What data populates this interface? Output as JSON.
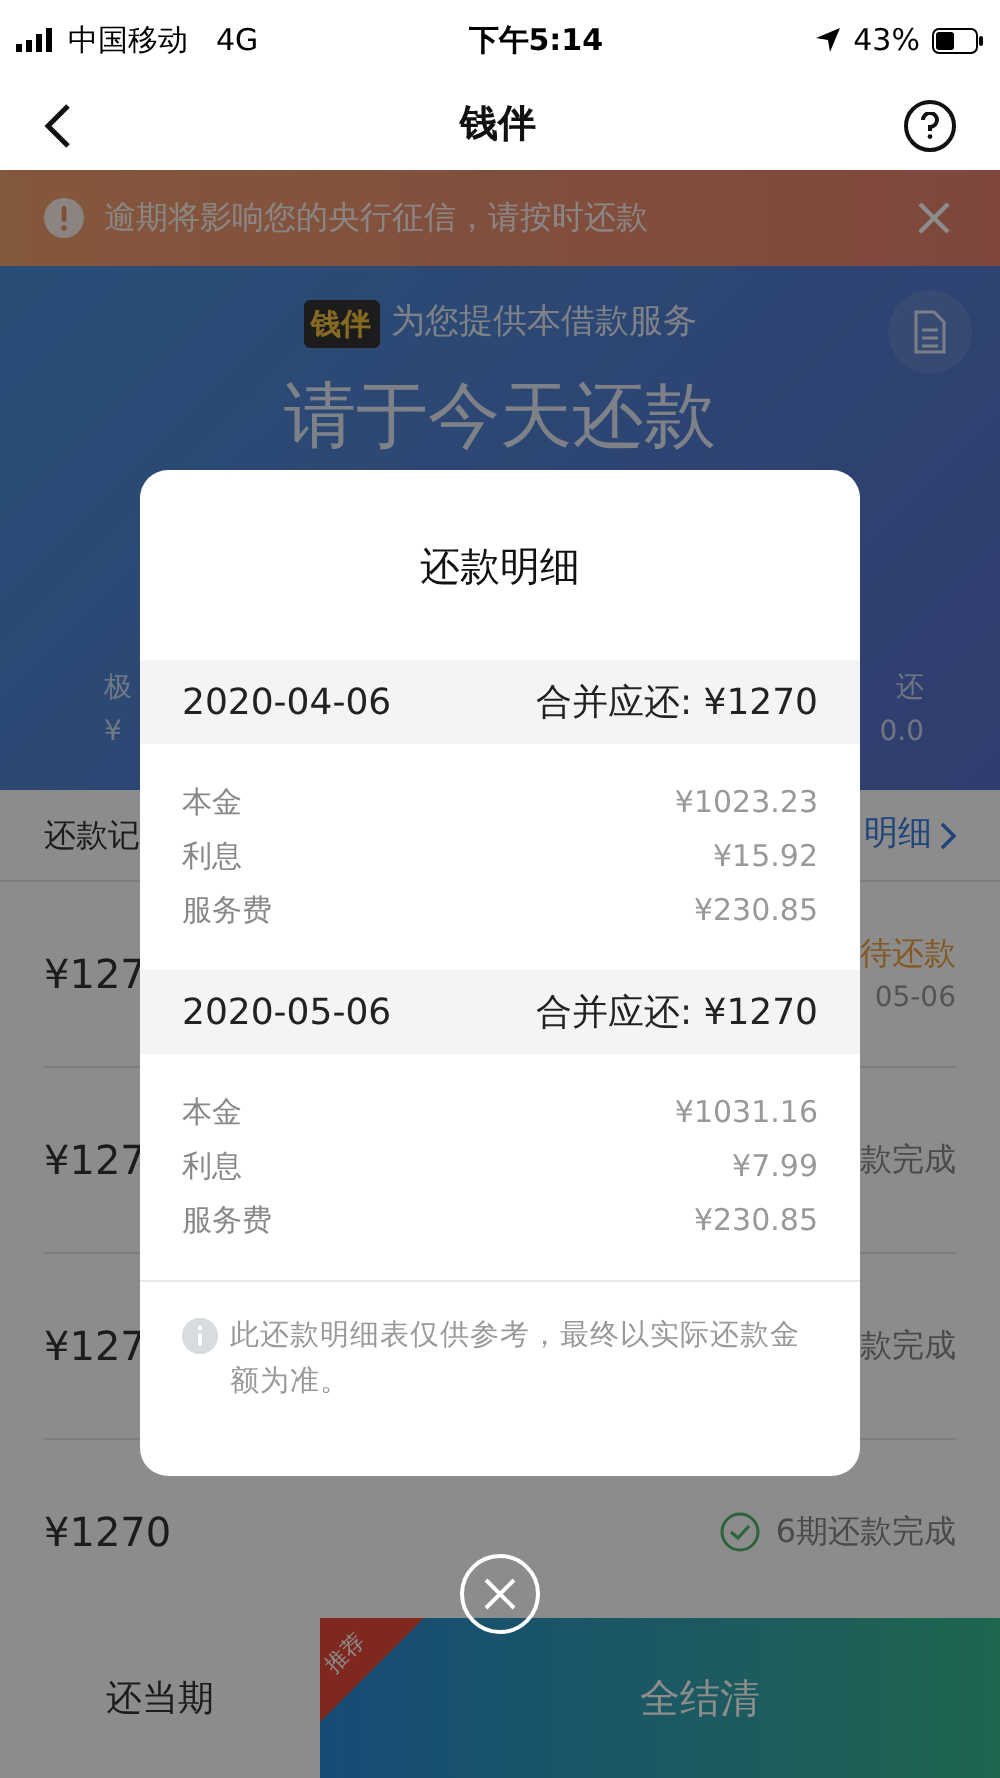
{
  "status_bar": {
    "carrier": "中国移动",
    "network": "4G",
    "time": "下午5:14",
    "battery": "43%"
  },
  "nav": {
    "title": "钱伴"
  },
  "alert": {
    "text": "逾期将影响您的央行征信，请按时还款"
  },
  "hero": {
    "brand": "钱伴",
    "tagline": "为您提供本借款服务",
    "title": "请于今天还款",
    "left_label": "极",
    "left_value": "¥",
    "right_label": "还",
    "right_value": "0.0"
  },
  "records": {
    "title": "还款记",
    "link": "明细"
  },
  "rows": [
    {
      "amount": "¥127",
      "kind": "pending",
      "status": "待还款",
      "date": "05-06",
      "icon": false
    },
    {
      "amount": "¥127",
      "kind": "done",
      "status": "款完成",
      "icon": false
    },
    {
      "amount": "¥127",
      "kind": "done",
      "status": "款完成",
      "icon": false
    },
    {
      "amount": "¥1270",
      "kind": "done",
      "status": "6期还款完成",
      "icon": true
    }
  ],
  "bottom_bar": {
    "left": "还当期",
    "badge": "推荐",
    "right": "全结清"
  },
  "modal": {
    "title": "还款明细",
    "groups": [
      {
        "date": "2020-04-06",
        "total": "合并应还: ¥1270",
        "items": [
          {
            "label": "本金",
            "value": "¥1023.23"
          },
          {
            "label": "利息",
            "value": "¥15.92"
          },
          {
            "label": "服务费",
            "value": "¥230.85"
          }
        ]
      },
      {
        "date": "2020-05-06",
        "total": "合并应还: ¥1270",
        "items": [
          {
            "label": "本金",
            "value": "¥1031.16"
          },
          {
            "label": "利息",
            "value": "¥7.99"
          },
          {
            "label": "服务费",
            "value": "¥230.85"
          }
        ]
      }
    ],
    "note": "此还款明细表仅供参考，最终以实际还款金额为准。"
  }
}
